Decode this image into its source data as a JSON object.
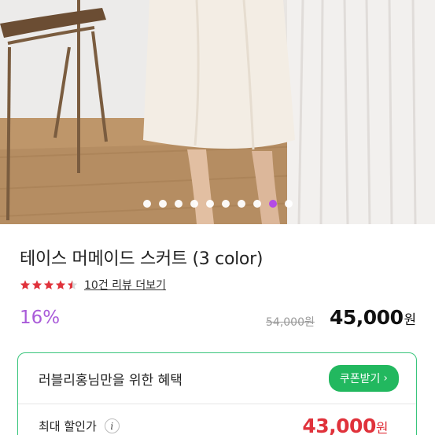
{
  "gallery": {
    "dot_count": 10,
    "active_index": 8,
    "active_color": "#b44be6"
  },
  "product": {
    "title": "테이스 머메이드 스커트 (3 color)",
    "rating": 4.5,
    "review_link": "10건 리뷰 더보기",
    "discount_rate": "16%",
    "original_price": "54,000원",
    "sale_price": "45,000",
    "price_unit": "원"
  },
  "benefit": {
    "title": "러블리홍님만을 위한 혜택",
    "coupon_button": "쿠폰받기",
    "max_label": "최대 할인가",
    "info_icon": "i",
    "max_price": "43,000",
    "price_unit": "원"
  },
  "colors": {
    "accent_green": "#22b85f",
    "discount_purple": "#a95bd9",
    "price_red": "#e0323b",
    "star_red": "#e0323b"
  }
}
